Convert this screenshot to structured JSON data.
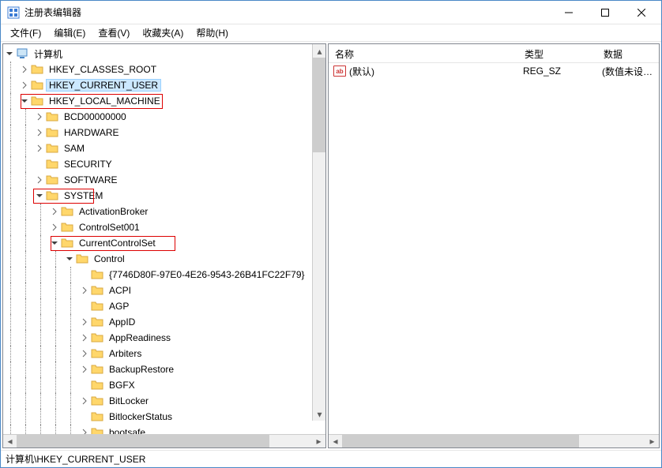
{
  "window": {
    "title": "注册表编辑器"
  },
  "menu": {
    "file": "文件(F)",
    "edit": "编辑(E)",
    "view": "查看(V)",
    "favorites": "收藏夹(A)",
    "help": "帮助(H)"
  },
  "tree": {
    "root": "计算机",
    "hkcr": "HKEY_CLASSES_ROOT",
    "hkcu": "HKEY_CURRENT_USER",
    "hklm": "HKEY_LOCAL_MACHINE",
    "bcd": "BCD00000000",
    "hardware": "HARDWARE",
    "sam": "SAM",
    "security": "SECURITY",
    "software": "SOFTWARE",
    "system": "SYSTEM",
    "activationbroker": "ActivationBroker",
    "controlset001": "ControlSet001",
    "currentcontrolset": "CurrentControlSet",
    "control": "Control",
    "guid": "{7746D80F-97E0-4E26-9543-26B41FC22F79}",
    "acpi": "ACPI",
    "agp": "AGP",
    "appid": "AppID",
    "appreadiness": "AppReadiness",
    "arbiters": "Arbiters",
    "backuprestore": "BackupRestore",
    "bgfx": "BGFX",
    "bitlocker": "BitLocker",
    "bitlockerstatus": "BitlockerStatus",
    "bootsafe": "bootsafe"
  },
  "list": {
    "headers": {
      "name": "名称",
      "type": "类型",
      "data": "数据"
    },
    "rows": [
      {
        "name": "(默认)",
        "type": "REG_SZ",
        "data": "(数值未设置)"
      }
    ]
  },
  "statusbar": {
    "path": "计算机\\HKEY_CURRENT_USER"
  }
}
